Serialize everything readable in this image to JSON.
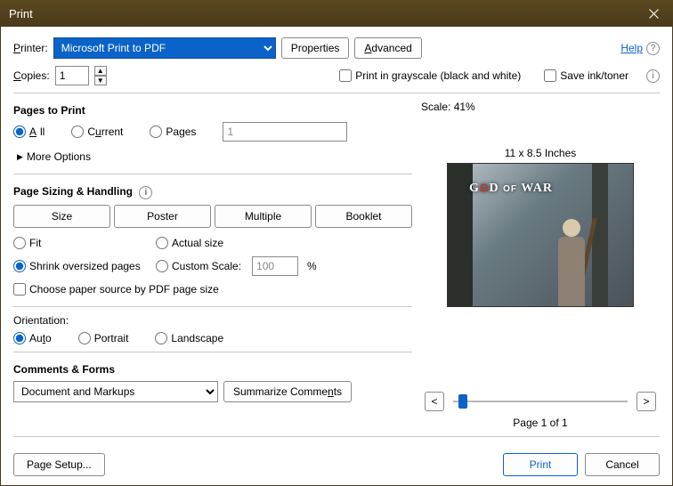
{
  "window": {
    "title": "Print"
  },
  "help": {
    "label": "Help"
  },
  "printer": {
    "label": "Printer:",
    "value": "Microsoft Print to PDF",
    "properties": "Properties",
    "advanced": "Advanced"
  },
  "copies": {
    "label": "Copies:",
    "value": "1"
  },
  "options": {
    "grayscale": "Print in grayscale (black and white)",
    "saveink": "Save ink/toner"
  },
  "pages": {
    "title": "Pages to Print",
    "all": "All",
    "current": "Current",
    "pages": "Pages",
    "range_value": "1",
    "more": "More Options"
  },
  "sizing": {
    "title": "Page Sizing & Handling",
    "size": "Size",
    "poster": "Poster",
    "multiple": "Multiple",
    "booklet": "Booklet",
    "fit": "Fit",
    "actual": "Actual size",
    "shrink": "Shrink oversized pages",
    "custom": "Custom Scale:",
    "custom_value": "100",
    "pct": "%",
    "choose_source": "Choose paper source by PDF page size"
  },
  "orientation": {
    "title": "Orientation:",
    "auto": "Auto",
    "portrait": "Portrait",
    "landscape": "Landscape"
  },
  "comments": {
    "title": "Comments & Forms",
    "value": "Document and Markups",
    "summarize": "Summarize Comments"
  },
  "preview": {
    "scale_label": "Scale:",
    "scale_value": "41%",
    "dimensions": "11 x 8.5 Inches",
    "logo": "GOD OF WAR",
    "page_status": "Page 1 of 1"
  },
  "footer": {
    "page_setup": "Page Setup...",
    "print": "Print",
    "cancel": "Cancel"
  }
}
